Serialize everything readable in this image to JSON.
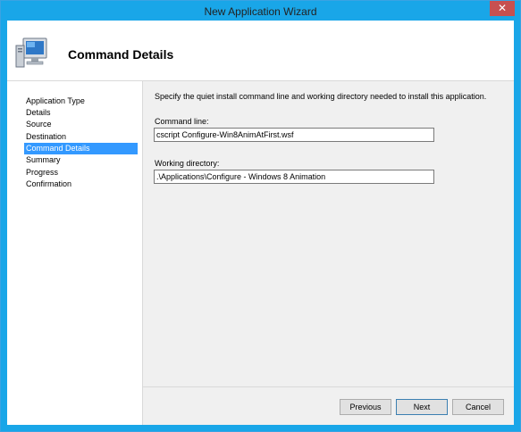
{
  "window": {
    "title": "New Application Wizard",
    "close_glyph": "✕"
  },
  "header": {
    "title": "Command Details",
    "icon": "computer-icon"
  },
  "nav": {
    "items": [
      {
        "label": "Application Type",
        "active": false
      },
      {
        "label": "Details",
        "active": false
      },
      {
        "label": "Source",
        "active": false
      },
      {
        "label": "Destination",
        "active": false
      },
      {
        "label": "Command Details",
        "active": true
      },
      {
        "label": "Summary",
        "active": false
      },
      {
        "label": "Progress",
        "active": false
      },
      {
        "label": "Confirmation",
        "active": false
      }
    ]
  },
  "main": {
    "description": "Specify the quiet install command line and working directory needed to install this application.",
    "command_line_label": "Command line:",
    "command_line_value": "cscript Configure-Win8AnimAtFirst.wsf",
    "working_dir_label": "Working directory:",
    "working_dir_value": ".\\Applications\\Configure - Windows 8 Animation"
  },
  "buttons": {
    "previous": "Previous",
    "next": "Next",
    "cancel": "Cancel"
  },
  "colors": {
    "titlebar": "#19a6e8",
    "selection": "#3399ff",
    "close": "#c75050"
  }
}
